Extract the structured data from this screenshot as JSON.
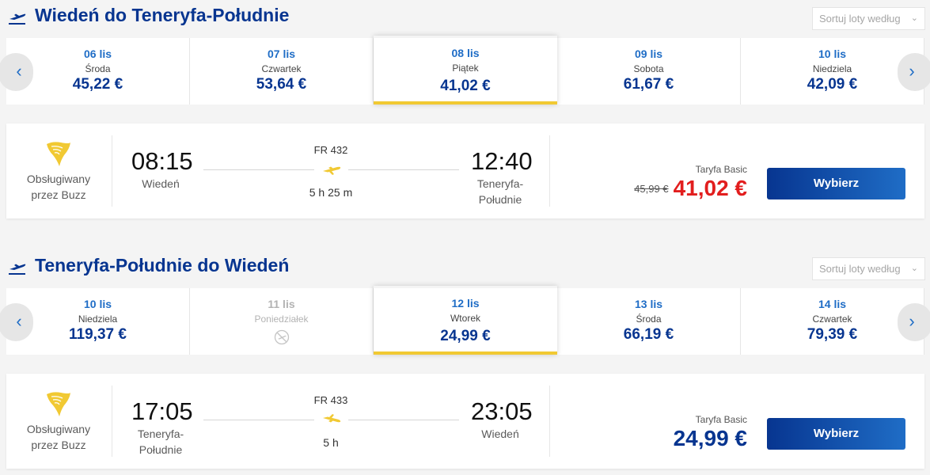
{
  "outbound": {
    "title": "Wiedeń do Teneryfa-Południe",
    "sort_label": "Sortuj loty według",
    "dates": [
      {
        "date": "06 lis",
        "weekday": "Środa",
        "price": "45,22 €"
      },
      {
        "date": "07 lis",
        "weekday": "Czwartek",
        "price": "53,64 €"
      },
      {
        "date": "08 lis",
        "weekday": "Piątek",
        "price": "41,02 €",
        "selected": true
      },
      {
        "date": "09 lis",
        "weekday": "Sobota",
        "price": "61,67 €"
      },
      {
        "date": "10 lis",
        "weekday": "Niedziela",
        "price": "42,09 €"
      }
    ],
    "flight": {
      "operator": "Obsługiwany przez Buzz",
      "dep_time": "08:15",
      "dep_city": "Wiedeń",
      "flight_no": "FR 432",
      "duration": "5 h 25 m",
      "arr_time": "12:40",
      "arr_city": "Teneryfa-Południe",
      "fare_label": "Taryfa Basic",
      "old_price": "45,99 €",
      "price": "41,02 €",
      "select_label": "Wybierz"
    }
  },
  "inbound": {
    "title": "Teneryfa-Południe do Wiedeń",
    "sort_label": "Sortuj loty według",
    "dates": [
      {
        "date": "10 lis",
        "weekday": "Niedziela",
        "price": "119,37 €"
      },
      {
        "date": "11 lis",
        "weekday": "Poniedziałek",
        "price": "",
        "disabled": true
      },
      {
        "date": "12 lis",
        "weekday": "Wtorek",
        "price": "24,99 €",
        "selected": true
      },
      {
        "date": "13 lis",
        "weekday": "Środa",
        "price": "66,19 €"
      },
      {
        "date": "14 lis",
        "weekday": "Czwartek",
        "price": "79,39 €"
      }
    ],
    "flight": {
      "operator": "Obsługiwany przez Buzz",
      "dep_time": "17:05",
      "dep_city": "Teneryfa-Południe",
      "flight_no": "FR 433",
      "duration": "5 h",
      "arr_time": "23:05",
      "arr_city": "Wiedeń",
      "fare_label": "Taryfa Basic",
      "price": "24,99 €",
      "select_label": "Wybierz"
    }
  },
  "colors": {
    "brand_blue": "#073590",
    "link_blue": "#1f6dc6",
    "accent_yellow": "#f1c933",
    "price_red": "#e21e1e"
  },
  "icons": {
    "departure": "airplane-takeoff-icon",
    "airline_logo": "ryanair-harp-logo",
    "flight_path": "airplane-icon",
    "no_flights": "no-flights-icon",
    "prev": "chevron-left-icon",
    "next": "chevron-right-icon",
    "sort_chevron": "chevron-down-icon"
  }
}
